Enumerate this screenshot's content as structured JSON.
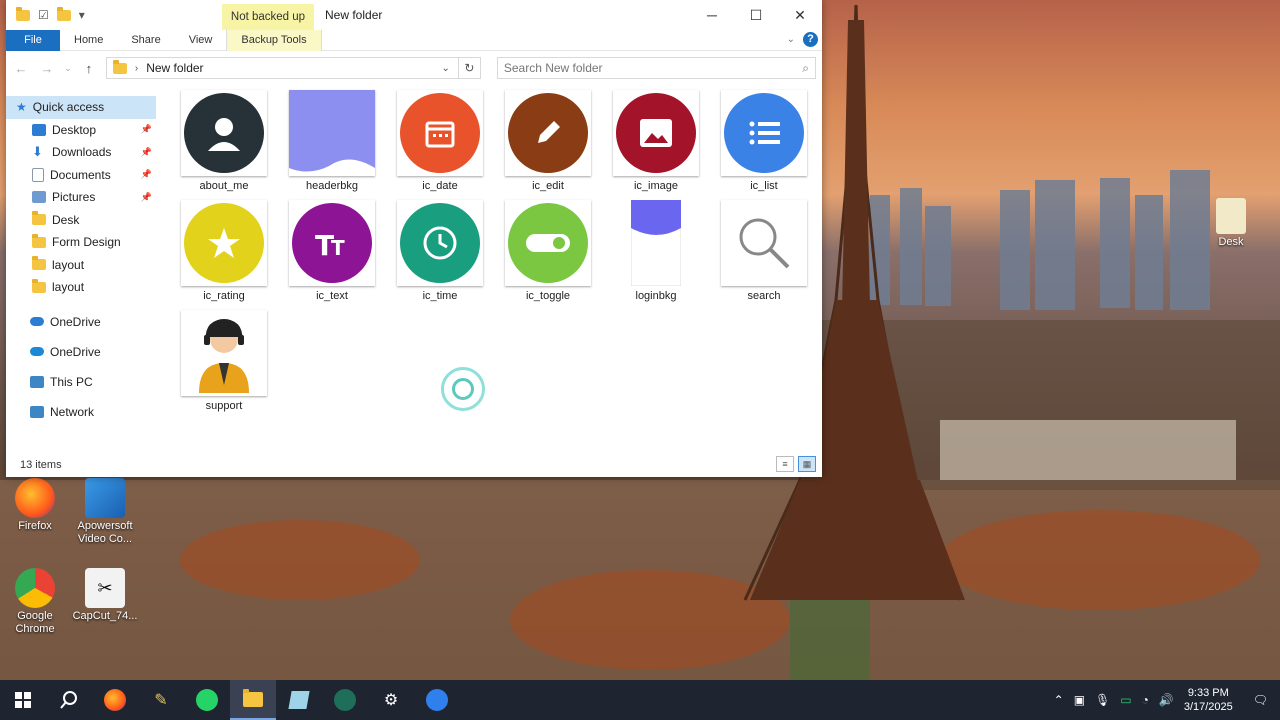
{
  "window": {
    "title": "New folder",
    "context_tab": "Not backed up",
    "ribbon_tabs": [
      "File",
      "Home",
      "Share",
      "View",
      "Backup Tools"
    ]
  },
  "address": {
    "path": "New folder",
    "search_placeholder": "Search New folder"
  },
  "nav": {
    "quick_access": "Quick access",
    "items": [
      {
        "label": "Desktop",
        "pinned": true,
        "icon": "desktop-icon",
        "color": "#2b7cd3"
      },
      {
        "label": "Downloads",
        "pinned": true,
        "icon": "download-icon",
        "color": "#2b7cd3"
      },
      {
        "label": "Documents",
        "pinned": true,
        "icon": "document-icon",
        "color": "#6d7b8a"
      },
      {
        "label": "Pictures",
        "pinned": true,
        "icon": "pictures-icon",
        "color": "#6d9bd1"
      },
      {
        "label": "Desk",
        "pinned": false,
        "icon": "folder-icon",
        "color": "#f5c542"
      },
      {
        "label": "Form Design",
        "pinned": false,
        "icon": "folder-icon",
        "color": "#f5c542"
      },
      {
        "label": "layout",
        "pinned": false,
        "icon": "folder-icon",
        "color": "#f5c542"
      },
      {
        "label": "layout",
        "pinned": false,
        "icon": "folder-icon",
        "color": "#f5c542"
      }
    ],
    "roots": [
      "OneDrive",
      "OneDrive",
      "This PC",
      "Network"
    ]
  },
  "files": [
    {
      "name": "about_me",
      "color": "#263238",
      "icon": "person-icon"
    },
    {
      "name": "headerbkg",
      "color": "#8c8ff0",
      "icon": "shape-icon"
    },
    {
      "name": "ic_date",
      "color": "#e8532c",
      "icon": "calendar-icon"
    },
    {
      "name": "ic_edit",
      "color": "#8a3d14",
      "icon": "pencil-icon"
    },
    {
      "name": "ic_image",
      "color": "#a3132a",
      "icon": "image-icon"
    },
    {
      "name": "ic_list",
      "color": "#3b82e6",
      "icon": "list-icon"
    },
    {
      "name": "ic_rating",
      "color": "#e3d21c",
      "icon": "star-icon"
    },
    {
      "name": "ic_text",
      "color": "#8e1496",
      "icon": "text-icon"
    },
    {
      "name": "ic_time",
      "color": "#1a9e80",
      "icon": "clock-icon"
    },
    {
      "name": "ic_toggle",
      "color": "#7bc742",
      "icon": "toggle-icon"
    },
    {
      "name": "loginbkg",
      "color": "#6a66f0",
      "icon": "shape-icon"
    },
    {
      "name": "search",
      "color": "#888888",
      "icon": "search-icon"
    },
    {
      "name": "support",
      "color": "#e8a21c",
      "icon": "support-agent-icon"
    }
  ],
  "status": {
    "item_count": "13 items"
  },
  "desktop_icons": [
    {
      "label": "Desk"
    },
    {
      "label": "Firefox"
    },
    {
      "label": "Apowersoft Video Co..."
    },
    {
      "label": "Google Chrome"
    },
    {
      "label": "CapCut_74..."
    }
  ],
  "taskbar": {
    "time": "9:33 PM",
    "date": "3/17/2025"
  }
}
